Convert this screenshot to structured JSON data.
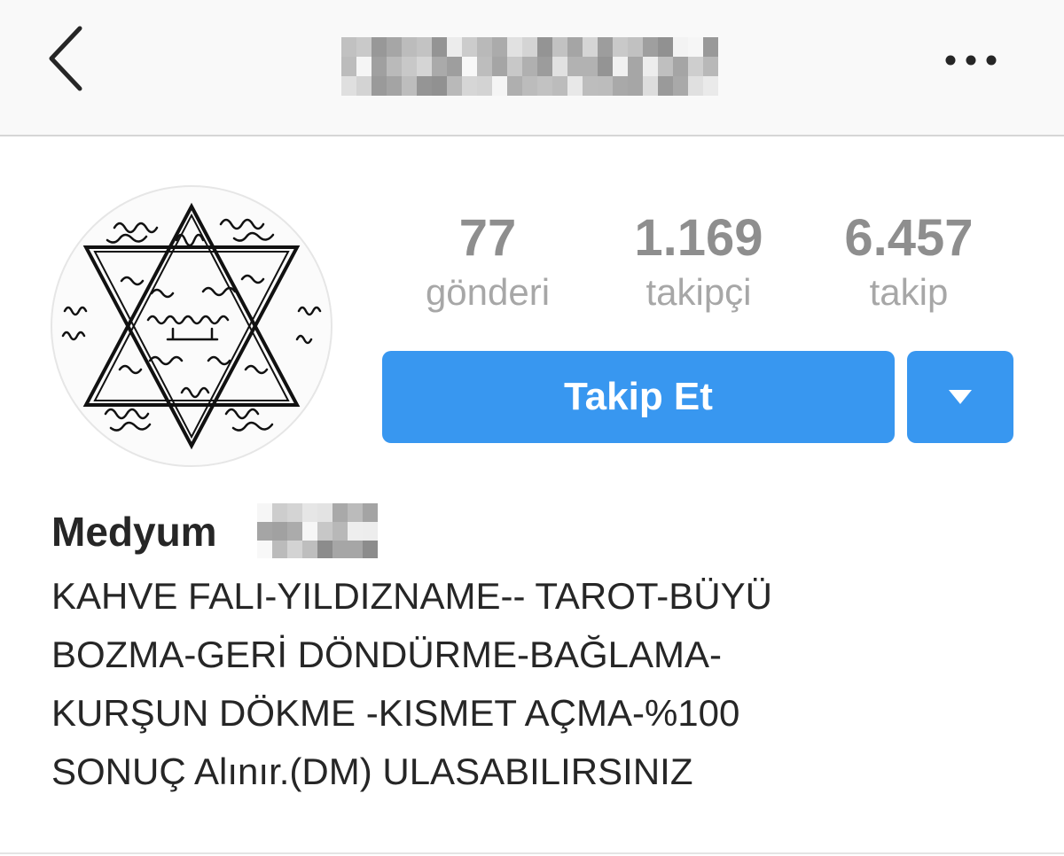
{
  "header": {
    "username_redacted": true,
    "back_icon": "chevron-left-icon",
    "more_icon": "ellipsis-horizontal-icon"
  },
  "profile": {
    "avatar": "hexagram-seal-avatar",
    "stats": [
      {
        "count": "77",
        "label": "gönderi"
      },
      {
        "count": "1.169",
        "label": "takipçi"
      },
      {
        "count": "6.457",
        "label": "takip"
      }
    ],
    "follow_button_label": "Takip Et",
    "dropdown_icon": "caret-down-icon",
    "display_name": "Medyum",
    "display_name_suffix_redacted": true,
    "bio_lines": [
      "KAHVE FALI-YILDIZNAME-- TAROT-BÜYÜ",
      "BOZMA-GERİ DÖNDÜRME-BAĞLAMA-",
      "KURŞUN DÖKME -KISMET AÇMA-%100",
      "SONUÇ Alınır.(DM) ULASABILIRSINIZ"
    ]
  },
  "colors": {
    "accent": "#3897f0",
    "stat_text": "#8e8e8e",
    "body_text": "#262626",
    "header_bg": "#f9f9f9"
  }
}
